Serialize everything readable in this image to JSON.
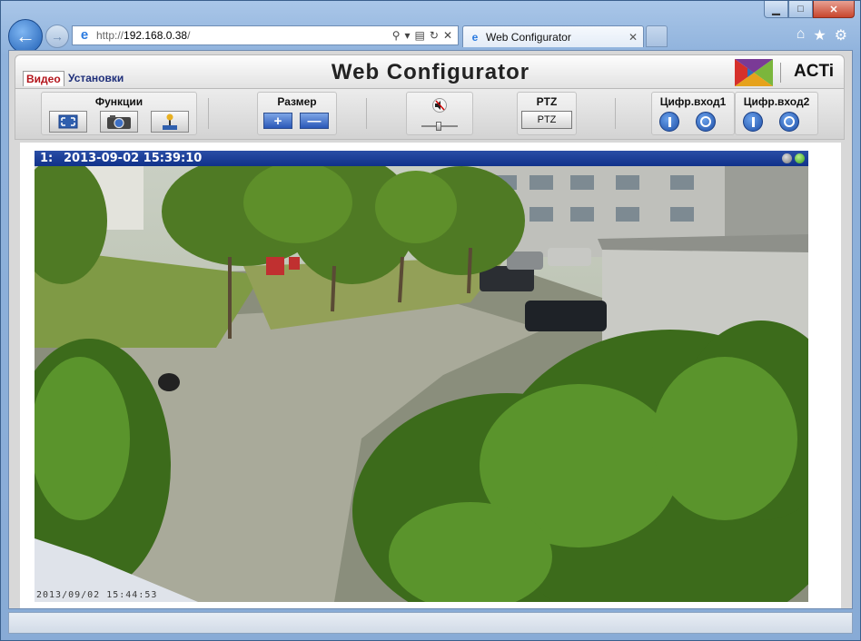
{
  "browser": {
    "url_prefix": "http://",
    "url_host": "192.168.0.38",
    "url_suffix": "/",
    "tab_title": "Web Configurator"
  },
  "app": {
    "title": "Web Configurator",
    "menu": {
      "video": "Видео",
      "setup": "Установки"
    },
    "logo_text": "ACTi",
    "groups": {
      "functions": "Функции",
      "size": "Размер",
      "ptz": "PTZ",
      "ptz_button": "PTZ",
      "din1": "Цифр.вход1",
      "din2": "Цифр.вход2"
    },
    "zoom_in": "+",
    "zoom_out": "—"
  },
  "video": {
    "channel": "1:",
    "timestamp": "2013-09-02 15:39:10",
    "osd_text": "2013/09/02 15:44:53"
  },
  "colors": {
    "title_bar_blue": "#10318a",
    "menu_active_red": "#b3141b"
  },
  "icons": {
    "fullscreen": "fullscreen-icon",
    "snapshot": "camera-icon",
    "record": "joystick-icon",
    "mute": "speaker-muted-icon"
  }
}
